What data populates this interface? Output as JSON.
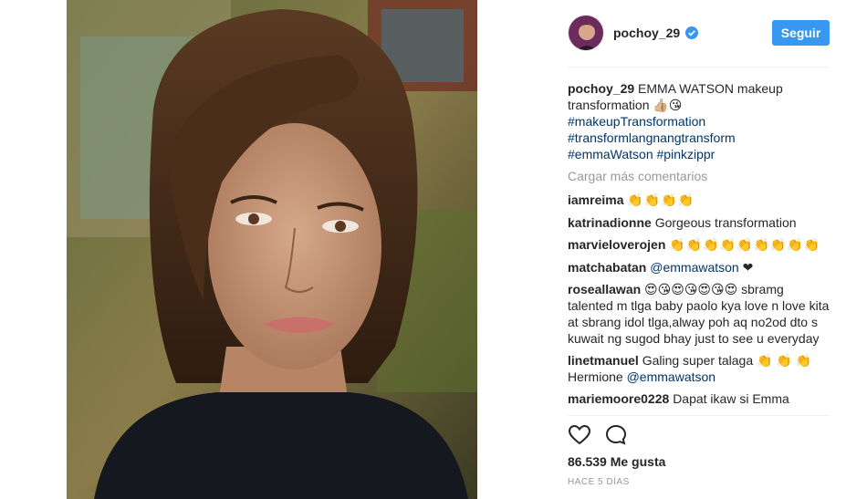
{
  "post": {
    "username": "pochoy_29",
    "follow_label": "Seguir",
    "caption_text": "EMMA WATSON makeup transformation 👍🏼😘",
    "hashtags": [
      "#makeupTransformation",
      "#transformlangnangtransform",
      "#emmaWatson #pinkzippr"
    ],
    "load_more": "Cargar más comentarios",
    "likes": "86.539 Me gusta",
    "time": "HACE 5 DÍAS"
  },
  "comments": [
    {
      "user": "iamreima",
      "text": "👏👏👏👏"
    },
    {
      "user": "katrinadionne",
      "text": "Gorgeous transformation"
    },
    {
      "user": "marvieloverojen",
      "text": "👏👏👏👏👏👏👏👏👏"
    },
    {
      "user": "matchabatan",
      "mention": "@emmawatson",
      "text": " ❤"
    },
    {
      "user": "roseallawan",
      "text": "😍😘😍😘😍😘😍 sbramg talented m tlga baby paolo kya love n love kita at sbrang idol tlga,alway poh aq no2od dto s kuwait ng sugod bhay just to see u everyday"
    },
    {
      "user": "linetmanuel",
      "text": "Galing super talaga 👏 👏 👏 Hermione ",
      "mention": "@emmawatson"
    },
    {
      "user": "mariemoore0228",
      "text": "Dapat ikaw si Emma"
    }
  ],
  "icons": {
    "verified": "verified-badge-icon",
    "like": "heart-icon",
    "comment": "comment-bubble-icon"
  },
  "colors": {
    "accent": "#3897f0",
    "link": "#003569",
    "muted": "#999999"
  }
}
